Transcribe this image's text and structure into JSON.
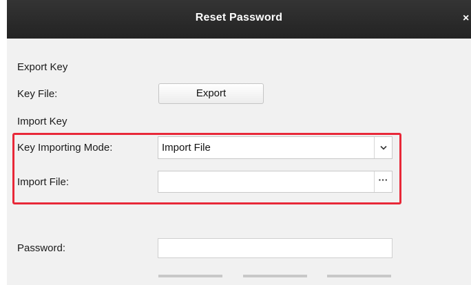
{
  "dialog": {
    "title": "Reset Password",
    "close_glyph": "×"
  },
  "export_section": {
    "heading": "Export Key",
    "key_file_label": "Key File:",
    "export_button_label": "Export"
  },
  "import_section": {
    "heading": "Import Key",
    "mode_label": "Key Importing Mode:",
    "mode_value": "Import File",
    "file_label": "Import File:",
    "file_value": "",
    "browse_glyph": "···"
  },
  "password_section": {
    "label": "Password:",
    "value": "",
    "strength_bar_count": 3
  },
  "icons": {
    "dropdown": "chevron-down-icon",
    "browse": "ellipsis-icon",
    "close": "close-icon"
  },
  "colors": {
    "titlebar": "#2a2a2a",
    "background": "#f1f1f1",
    "highlight": "#e82838"
  }
}
